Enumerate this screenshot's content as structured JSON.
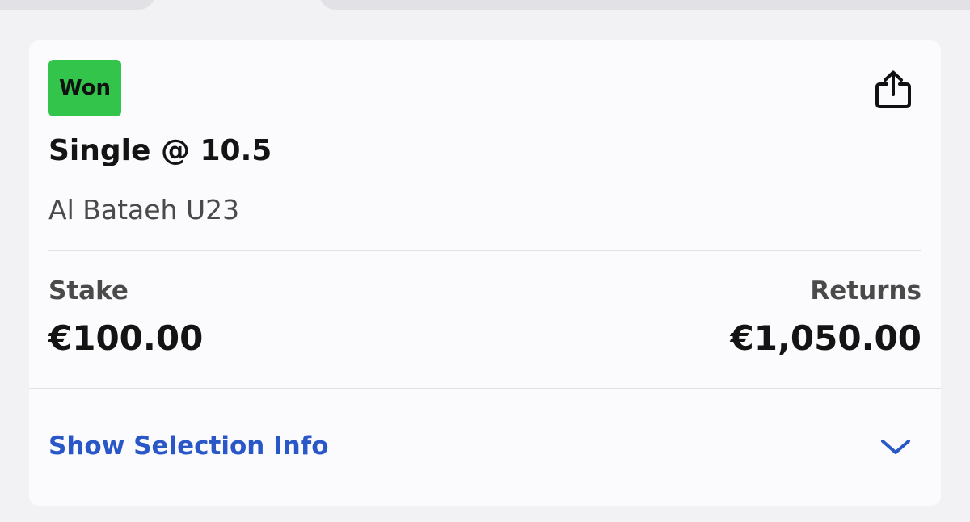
{
  "bet": {
    "status": "Won",
    "title": "Single @ 10.5",
    "selection": "Al Bataeh U23",
    "stake_label": "Stake",
    "stake_value": "€100.00",
    "returns_label": "Returns",
    "returns_value": "€1,050.00",
    "info_toggle_label": "Show Selection Info"
  },
  "icons": {
    "share": "share-icon",
    "expand": "chevron-down-icon"
  },
  "colors": {
    "won_badge": "#33c44c",
    "link": "#2a57c7"
  }
}
